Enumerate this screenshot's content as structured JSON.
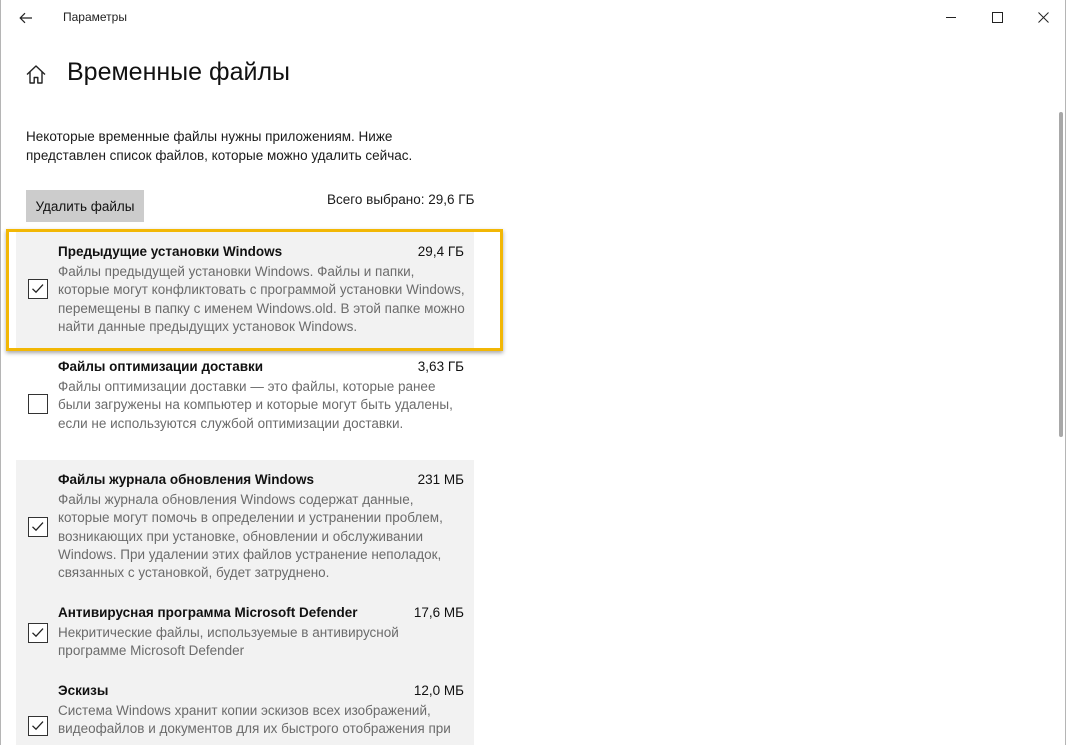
{
  "window": {
    "title": "Параметры"
  },
  "page": {
    "title": "Временные файлы"
  },
  "description": "Некоторые временные файлы нужны приложениям. Ниже представлен список файлов, которые можно удалить сейчас.",
  "actions": {
    "delete_label": "Удалить файлы",
    "total_selected": "Всего выбрано: 29,6 ГБ"
  },
  "colors": {
    "highlight": "#f2b705",
    "item_shade": "#f2f2f2",
    "button": "#cccccc"
  },
  "items": [
    {
      "name": "Предыдущие установки Windows",
      "size": "29,4 ГБ",
      "checked": true,
      "text": "Файлы предыдущей установки Windows.  Файлы и папки, которые могут конфликтовать с программой установки Windows, перемещены в папку с именем Windows.old.  В этой папке можно найти данные предыдущих установок Windows."
    },
    {
      "name": "Файлы оптимизации доставки",
      "size": "3,63 ГБ",
      "checked": false,
      "text": "Файлы оптимизации доставки — это файлы, которые ранее были загружены на компьютер и которые могут быть удалены, если не используются службой оптимизации доставки."
    },
    {
      "name": "Файлы журнала обновления Windows",
      "size": "231 МБ",
      "checked": true,
      "text": "Файлы журнала обновления Windows содержат данные, которые могут помочь в определении и устранении проблем, возникающих при установке, обновлении и обслуживании Windows. При удалении этих файлов устранение неполадок, связанных с установкой, будет затруднено."
    },
    {
      "name": "Антивирусная программа Microsoft Defender",
      "size": "17,6 МБ",
      "checked": true,
      "text": "Некритические файлы, используемые в антивирусной программе Microsoft Defender"
    },
    {
      "name": "Эскизы",
      "size": "12,0 МБ",
      "checked": true,
      "text": "Система Windows хранит копии эскизов всех изображений, видеофайлов и документов для их быстрого отображения при"
    }
  ]
}
